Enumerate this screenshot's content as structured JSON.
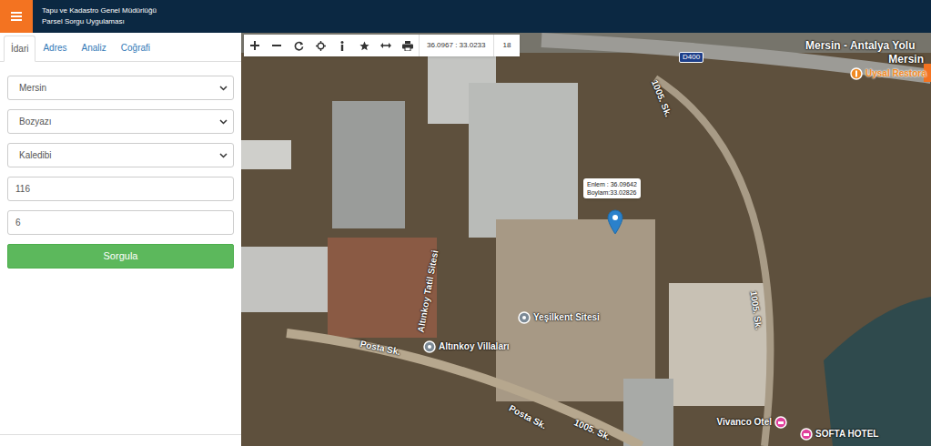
{
  "header": {
    "title": "Tapu ve Kadastro Genel Müdürlüğü",
    "subtitle": "Parsel Sorgu Uygulaması"
  },
  "tabs": [
    {
      "label": "İdari",
      "selected": true
    },
    {
      "label": "Adres",
      "selected": false
    },
    {
      "label": "Analiz",
      "selected": false
    },
    {
      "label": "Coğrafi",
      "selected": false
    }
  ],
  "form": {
    "province": "Mersin",
    "district": "Bozyazı",
    "neighborhood": "Kaledibi",
    "block": "116",
    "parcel": "6",
    "submit": "Sorgula"
  },
  "map": {
    "toolbar": {
      "coordinates": "36.0967 : 33.0233",
      "zoom": "18"
    },
    "marker_popup": {
      "latitude": "Enlem : 36.09642",
      "longitude": "Boylam:33.02826"
    },
    "area_labels": [
      "Mersin - Antalya Yolu",
      "Mersin"
    ],
    "route_shield": "D400",
    "road_labels": [
      "1005. Sk.",
      "1005. Sk.",
      "1005. Sk.",
      "Posta Sk.",
      "Posta Sk.",
      "Altınkoy Tatil Sitesi"
    ],
    "places": [
      {
        "name": "Uysal Restora",
        "kind": "restaurant"
      },
      {
        "name": "Yeşilkent Sitesi",
        "kind": "site"
      },
      {
        "name": "Altınkoy Villaları",
        "kind": "site"
      },
      {
        "name": "Vivanco Otel",
        "kind": "hotel"
      },
      {
        "name": "SOFTA HOTEL",
        "kind": "hotel"
      }
    ]
  }
}
